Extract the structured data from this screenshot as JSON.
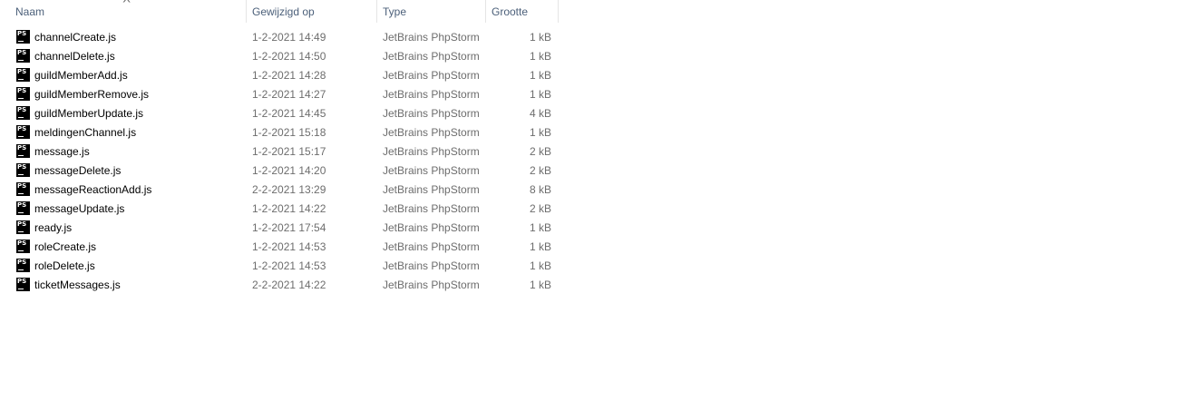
{
  "columns": {
    "name": "Naam",
    "modified": "Gewijzigd op",
    "type": "Type",
    "size": "Grootte"
  },
  "sort_icon": "chevron-up-icon",
  "file_icon": "phpstorm-file-icon",
  "file_icon_text": "PS",
  "files": [
    {
      "name": "channelCreate.js",
      "modified": "1-2-2021 14:49",
      "type": "JetBrains PhpStorm",
      "size": "1 kB"
    },
    {
      "name": "channelDelete.js",
      "modified": "1-2-2021 14:50",
      "type": "JetBrains PhpStorm",
      "size": "1 kB"
    },
    {
      "name": "guildMemberAdd.js",
      "modified": "1-2-2021 14:28",
      "type": "JetBrains PhpStorm",
      "size": "1 kB"
    },
    {
      "name": "guildMemberRemove.js",
      "modified": "1-2-2021 14:27",
      "type": "JetBrains PhpStorm",
      "size": "1 kB"
    },
    {
      "name": "guildMemberUpdate.js",
      "modified": "1-2-2021 14:45",
      "type": "JetBrains PhpStorm",
      "size": "4 kB"
    },
    {
      "name": "meldingenChannel.js",
      "modified": "1-2-2021 15:18",
      "type": "JetBrains PhpStorm",
      "size": "1 kB"
    },
    {
      "name": "message.js",
      "modified": "1-2-2021 15:17",
      "type": "JetBrains PhpStorm",
      "size": "2 kB"
    },
    {
      "name": "messageDelete.js",
      "modified": "1-2-2021 14:20",
      "type": "JetBrains PhpStorm",
      "size": "2 kB"
    },
    {
      "name": "messageReactionAdd.js",
      "modified": "2-2-2021 13:29",
      "type": "JetBrains PhpStorm",
      "size": "8 kB"
    },
    {
      "name": "messageUpdate.js",
      "modified": "1-2-2021 14:22",
      "type": "JetBrains PhpStorm",
      "size": "2 kB"
    },
    {
      "name": "ready.js",
      "modified": "1-2-2021 17:54",
      "type": "JetBrains PhpStorm",
      "size": "1 kB"
    },
    {
      "name": "roleCreate.js",
      "modified": "1-2-2021 14:53",
      "type": "JetBrains PhpStorm",
      "size": "1 kB"
    },
    {
      "name": "roleDelete.js",
      "modified": "1-2-2021 14:53",
      "type": "JetBrains PhpStorm",
      "size": "1 kB"
    },
    {
      "name": "ticketMessages.js",
      "modified": "2-2-2021 14:22",
      "type": "JetBrains PhpStorm",
      "size": "1 kB"
    }
  ]
}
